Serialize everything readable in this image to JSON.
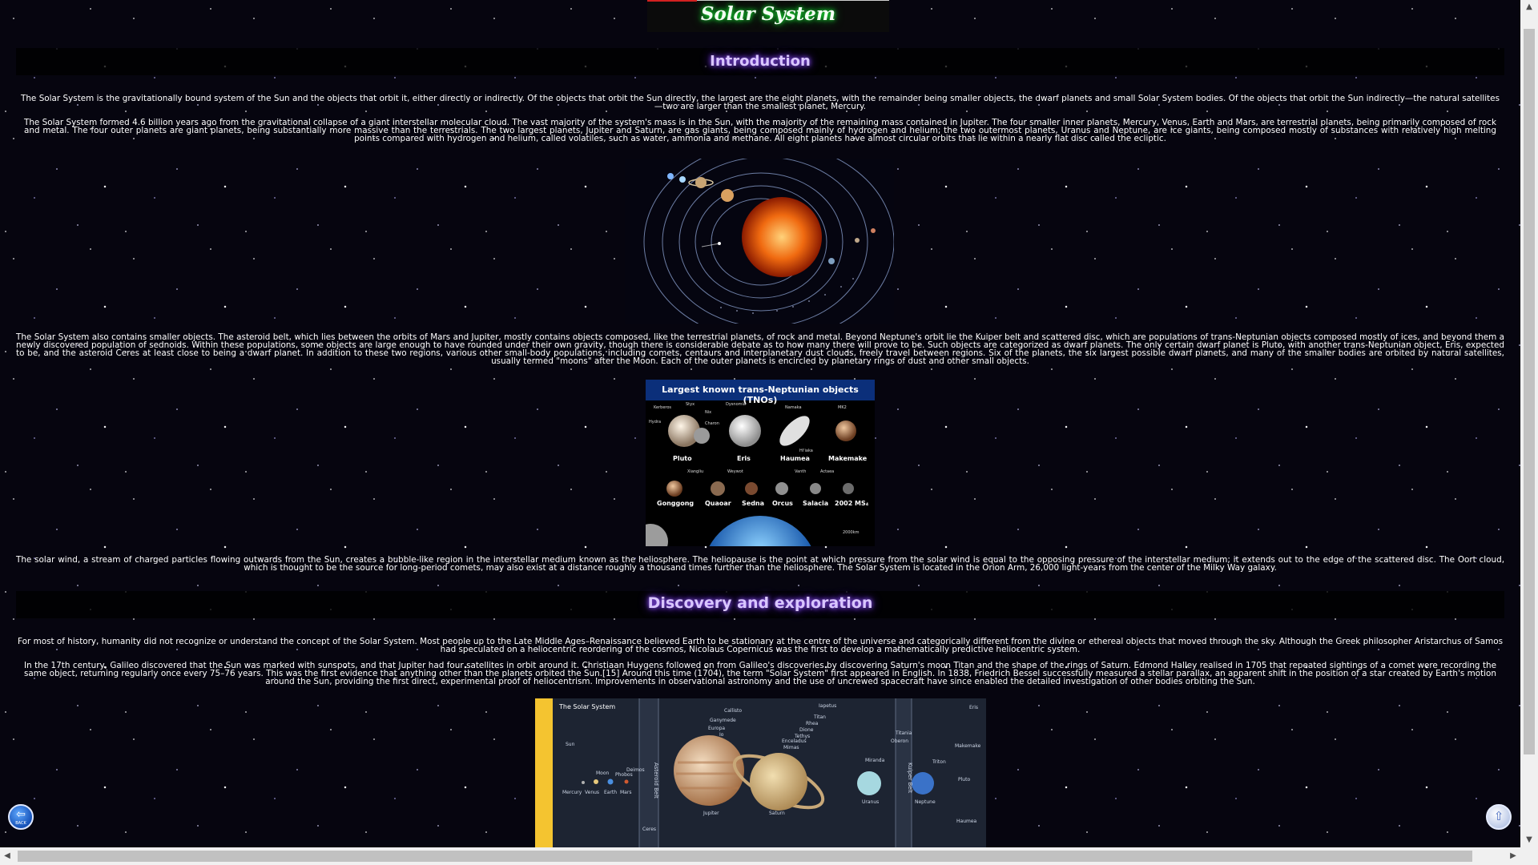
{
  "header": {
    "title": "Solar System"
  },
  "sections": {
    "introduction": {
      "title": "Introduction"
    },
    "discovery": {
      "title": "Discovery and exploration"
    }
  },
  "paragraphs": {
    "p1": "The Solar System is the gravitationally bound system of the Sun and the objects that orbit it, either directly or indirectly. Of the objects that orbit the Sun directly, the largest are the eight planets, with the remainder being smaller objects, the dwarf planets and small Solar System bodies. Of the objects that orbit the Sun indirectly—the natural satellites—two are larger than the smallest planet, Mercury.",
    "p2": "The Solar System formed 4.6 billion years ago from the gravitational collapse of a giant interstellar molecular cloud. The vast majority of the system's mass is in the Sun, with the majority of the remaining mass contained in Jupiter. The four smaller inner planets, Mercury, Venus, Earth and Mars, are terrestrial planets, being primarily composed of rock and metal. The four outer planets are giant planets, being substantially more massive than the terrestrials. The two largest planets, Jupiter and Saturn, are gas giants, being composed mainly of hydrogen and helium; the two outermost planets, Uranus and Neptune, are ice giants, being composed mostly of substances with relatively high melting points compared with hydrogen and helium, called volatiles, such as water, ammonia and methane. All eight planets have almost circular orbits that lie within a nearly flat disc called the ecliptic.",
    "p3": "The Solar System also contains smaller objects. The asteroid belt, which lies between the orbits of Mars and Jupiter, mostly contains objects composed, like the terrestrial planets, of rock and metal. Beyond Neptune's orbit lie the Kuiper belt and scattered disc, which are populations of trans-Neptunian objects composed mostly of ices, and beyond them a newly discovered population of sednoids. Within these populations, some objects are large enough to have rounded under their own gravity, though there is considerable debate as to how many there will prove to be. Such objects are categorized as dwarf planets. The only certain dwarf planet is Pluto, with another trans-Neptunian object, Eris, expected to be, and the asteroid Ceres at least close to being a dwarf planet. In addition to these two regions, various other small-body populations, including comets, centaurs and interplanetary dust clouds, freely travel between regions. Six of the planets, the six largest possible dwarf planets, and many of the smaller bodies are orbited by natural satellites, usually termed \"moons\" after the Moon. Each of the outer planets is encircled by planetary rings of dust and other small objects.",
    "p4": "The solar wind, a stream of charged particles flowing outwards from the Sun, creates a bubble-like region in the interstellar medium known as the heliosphere. The heliopause is the point at which pressure from the solar wind is equal to the opposing pressure of the interstellar medium; it extends out to the edge of the scattered disc. The Oort cloud, which is thought to be the source for long-period comets, may also exist at a distance roughly a thousand times further than the heliosphere. The Solar System is located in the Orion Arm, 26,000 light-years from the center of the Milky Way galaxy.",
    "p5": "For most of history, humanity did not recognize or understand the concept of the Solar System. Most people up to the Late Middle Ages–Renaissance believed Earth to be stationary at the centre of the universe and categorically different from the divine or ethereal objects that moved through the sky. Although the Greek philosopher Aristarchus of Samos had speculated on a heliocentric reordering of the cosmos, Nicolaus Copernicus was the first to develop a mathematically predictive heliocentric system.",
    "p6": "In the 17th century, Galileo discovered that the Sun was marked with sunspots, and that Jupiter had four satellites in orbit around it. Christiaan Huygens followed on from Galileo's discoveries by discovering Saturn's moon Titan and the shape of the rings of Saturn. Edmond Halley realised in 1705 that repeated sightings of a comet were recording the same object, returning regularly once every 75–76 years. This was the first evidence that anything other than the planets orbited the Sun.[15] Around this time (1704), the term \"Solar System\" first appeared in English. In 1838, Friedrich Bessel successfully measured a stellar parallax, an apparent shift in the position of a star created by Earth's motion around the Sun, providing the first direct, experimental proof of heliocentrism. Improvements in observational astronomy and the use of uncrewed spacecraft have since enabled the detailed investigation of other bodies orbiting the Sun."
  },
  "figures": {
    "tno": {
      "title": "Largest known trans-Neptunian objects (TNOs)",
      "row1": [
        "Pluto",
        "Eris",
        "Haumea",
        "Makemake"
      ],
      "row2": [
        "Gonggong",
        "Quaoar",
        "Sedna",
        "Orcus",
        "Salacia",
        "2002 MS₄"
      ],
      "moons": [
        "Kerberos",
        "Styx",
        "Nix",
        "Dysnomia",
        "Namaka",
        "MK2",
        "Hydra",
        "Charon",
        "Hi'iaka",
        "Xiangliu",
        "Weywot",
        "Vanth",
        "Actaea"
      ],
      "scale": "2000km"
    },
    "chart": {
      "title": "The Solar System",
      "bodies": [
        "Sun",
        "Mercury",
        "Venus",
        "Earth",
        "Mars",
        "Jupiter",
        "Saturn",
        "Uranus",
        "Neptune",
        "Ceres",
        "Pluto",
        "Eris",
        "Makemake",
        "Haumea"
      ],
      "belts": [
        "Asteroid Belt",
        "Kuiper Belt"
      ],
      "moons_visible": [
        "Callisto",
        "Ganymede",
        "Europa",
        "Io",
        "Titania",
        "Oberon",
        "Titan",
        "Rhea",
        "Iapetus",
        "Dione",
        "Tethys",
        "Enceladus",
        "Mimas",
        "Miranda",
        "Triton",
        "Moon",
        "Phobos",
        "Deimos"
      ]
    }
  },
  "controls": {
    "back_label": "BACK"
  }
}
